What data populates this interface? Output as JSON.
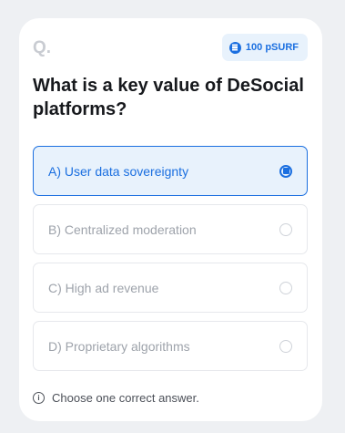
{
  "quiz": {
    "q_label": "Q.",
    "reward": "100 pSURF",
    "question": "What is a key value of DeSocial platforms?",
    "options": [
      {
        "label": "A) User data sovereignty",
        "selected": true
      },
      {
        "label": "B) Centralized moderation",
        "selected": false
      },
      {
        "label": "C) High ad revenue",
        "selected": false
      },
      {
        "label": "D) Proprietary algorithms",
        "selected": false
      }
    ],
    "hint": "Choose one correct answer."
  },
  "colors": {
    "accent": "#1b6fe0",
    "selected_bg": "#e8f2fc",
    "muted_text": "#9ea3ab"
  },
  "icons": {
    "reward": "coin-icon",
    "hint": "info-icon"
  }
}
